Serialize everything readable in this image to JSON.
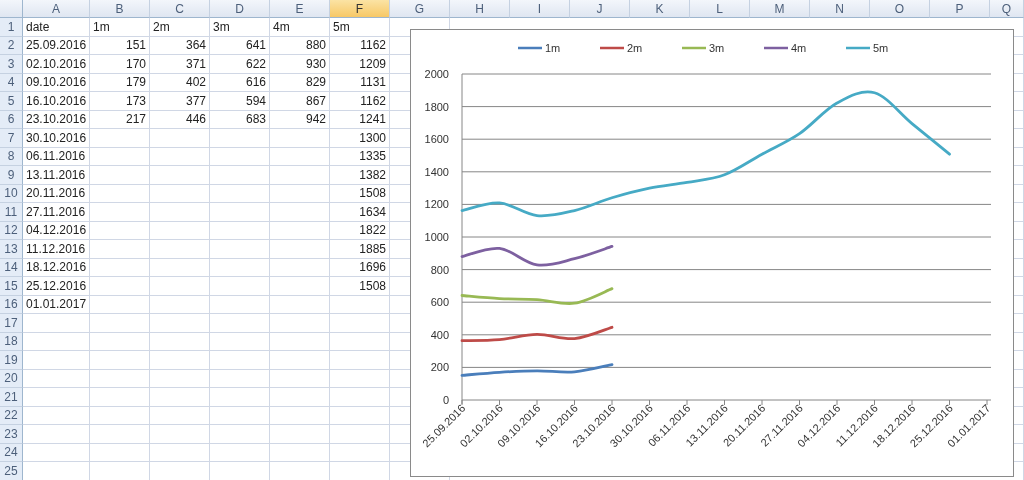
{
  "columns": [
    {
      "label": "A",
      "selected": false
    },
    {
      "label": "B",
      "selected": false
    },
    {
      "label": "C",
      "selected": false
    },
    {
      "label": "D",
      "selected": false
    },
    {
      "label": "E",
      "selected": false
    },
    {
      "label": "F",
      "selected": true
    },
    {
      "label": "G",
      "selected": false
    },
    {
      "label": "H",
      "selected": false
    },
    {
      "label": "I",
      "selected": false
    },
    {
      "label": "J",
      "selected": false
    },
    {
      "label": "K",
      "selected": false
    },
    {
      "label": "L",
      "selected": false
    },
    {
      "label": "M",
      "selected": false
    },
    {
      "label": "N",
      "selected": false
    },
    {
      "label": "O",
      "selected": false
    },
    {
      "label": "P",
      "selected": false
    },
    {
      "label": "Q",
      "selected": false
    }
  ],
  "rows": [
    {
      "number": "1",
      "kind": "header",
      "cells": [
        "date",
        "1m",
        "2m",
        "3m",
        "4m",
        "5m"
      ]
    },
    {
      "number": "2",
      "kind": "data",
      "cells": [
        "25.09.2016",
        "151",
        "364",
        "641",
        "880",
        "1162"
      ]
    },
    {
      "number": "3",
      "kind": "data",
      "cells": [
        "02.10.2016",
        "170",
        "371",
        "622",
        "930",
        "1209"
      ]
    },
    {
      "number": "4",
      "kind": "data",
      "cells": [
        "09.10.2016",
        "179",
        "402",
        "616",
        "829",
        "1131"
      ]
    },
    {
      "number": "5",
      "kind": "data",
      "cells": [
        "16.10.2016",
        "173",
        "377",
        "594",
        "867",
        "1162"
      ]
    },
    {
      "number": "6",
      "kind": "data",
      "cells": [
        "23.10.2016",
        "217",
        "446",
        "683",
        "942",
        "1241"
      ]
    },
    {
      "number": "7",
      "kind": "data",
      "cells": [
        "30.10.2016",
        null,
        null,
        null,
        null,
        "1300"
      ]
    },
    {
      "number": "8",
      "kind": "data",
      "cells": [
        "06.11.2016",
        null,
        null,
        null,
        null,
        "1335"
      ]
    },
    {
      "number": "9",
      "kind": "data",
      "cells": [
        "13.11.2016",
        null,
        null,
        null,
        null,
        "1382"
      ]
    },
    {
      "number": "10",
      "kind": "data",
      "cells": [
        "20.11.2016",
        null,
        null,
        null,
        null,
        "1508"
      ]
    },
    {
      "number": "11",
      "kind": "data",
      "cells": [
        "27.11.2016",
        null,
        null,
        null,
        null,
        "1634"
      ]
    },
    {
      "number": "12",
      "kind": "data",
      "cells": [
        "04.12.2016",
        null,
        null,
        null,
        null,
        "1822"
      ]
    },
    {
      "number": "13",
      "kind": "data",
      "cells": [
        "11.12.2016",
        null,
        null,
        null,
        null,
        "1885"
      ]
    },
    {
      "number": "14",
      "kind": "data",
      "cells": [
        "18.12.2016",
        null,
        null,
        null,
        null,
        "1696"
      ]
    },
    {
      "number": "15",
      "kind": "data",
      "cells": [
        "25.12.2016",
        null,
        null,
        null,
        null,
        "1508"
      ]
    },
    {
      "number": "16",
      "kind": "data",
      "cells": [
        "01.01.2017"
      ]
    },
    {
      "number": "17",
      "kind": "data"
    },
    {
      "number": "18",
      "kind": "data"
    },
    {
      "number": "19",
      "kind": "data"
    },
    {
      "number": "20",
      "kind": "data"
    },
    {
      "number": "21",
      "kind": "data"
    },
    {
      "number": "22",
      "kind": "data"
    },
    {
      "number": "23",
      "kind": "data"
    },
    {
      "number": "24",
      "kind": "data"
    },
    {
      "number": "25",
      "kind": "data"
    }
  ],
  "chart": {
    "chart_data": {
      "type": "line",
      "categories": [
        "25.09.2016",
        "02.10.2016",
        "09.10.2016",
        "16.10.2016",
        "23.10.2016",
        "30.10.2016",
        "06.11.2016",
        "13.11.2016",
        "20.11.2016",
        "27.11.2016",
        "04.12.2016",
        "11.12.2016",
        "18.12.2016",
        "25.12.2016",
        "01.01.2017"
      ],
      "series": [
        {
          "name": "1m",
          "color": "#4a7ebb",
          "values": [
            151,
            170,
            179,
            173,
            217,
            null,
            null,
            null,
            null,
            null,
            null,
            null,
            null,
            null,
            null
          ]
        },
        {
          "name": "2m",
          "color": "#be4b48",
          "values": [
            364,
            371,
            402,
            377,
            446,
            null,
            null,
            null,
            null,
            null,
            null,
            null,
            null,
            null,
            null
          ]
        },
        {
          "name": "3m",
          "color": "#98b954",
          "values": [
            641,
            622,
            616,
            594,
            683,
            null,
            null,
            null,
            null,
            null,
            null,
            null,
            null,
            null,
            null
          ]
        },
        {
          "name": "4m",
          "color": "#7d60a0",
          "values": [
            880,
            930,
            829,
            867,
            942,
            null,
            null,
            null,
            null,
            null,
            null,
            null,
            null,
            null,
            null
          ]
        },
        {
          "name": "5m",
          "color": "#46aac5",
          "values": [
            1162,
            1209,
            1131,
            1162,
            1241,
            1300,
            1335,
            1382,
            1508,
            1634,
            1822,
            1885,
            1696,
            1508,
            null
          ]
        }
      ],
      "grid": true,
      "legend": true,
      "ylim": [
        0,
        2000
      ],
      "yticks": [
        0,
        200,
        400,
        600,
        800,
        1000,
        1200,
        1400,
        1600,
        1800,
        2000
      ]
    }
  }
}
